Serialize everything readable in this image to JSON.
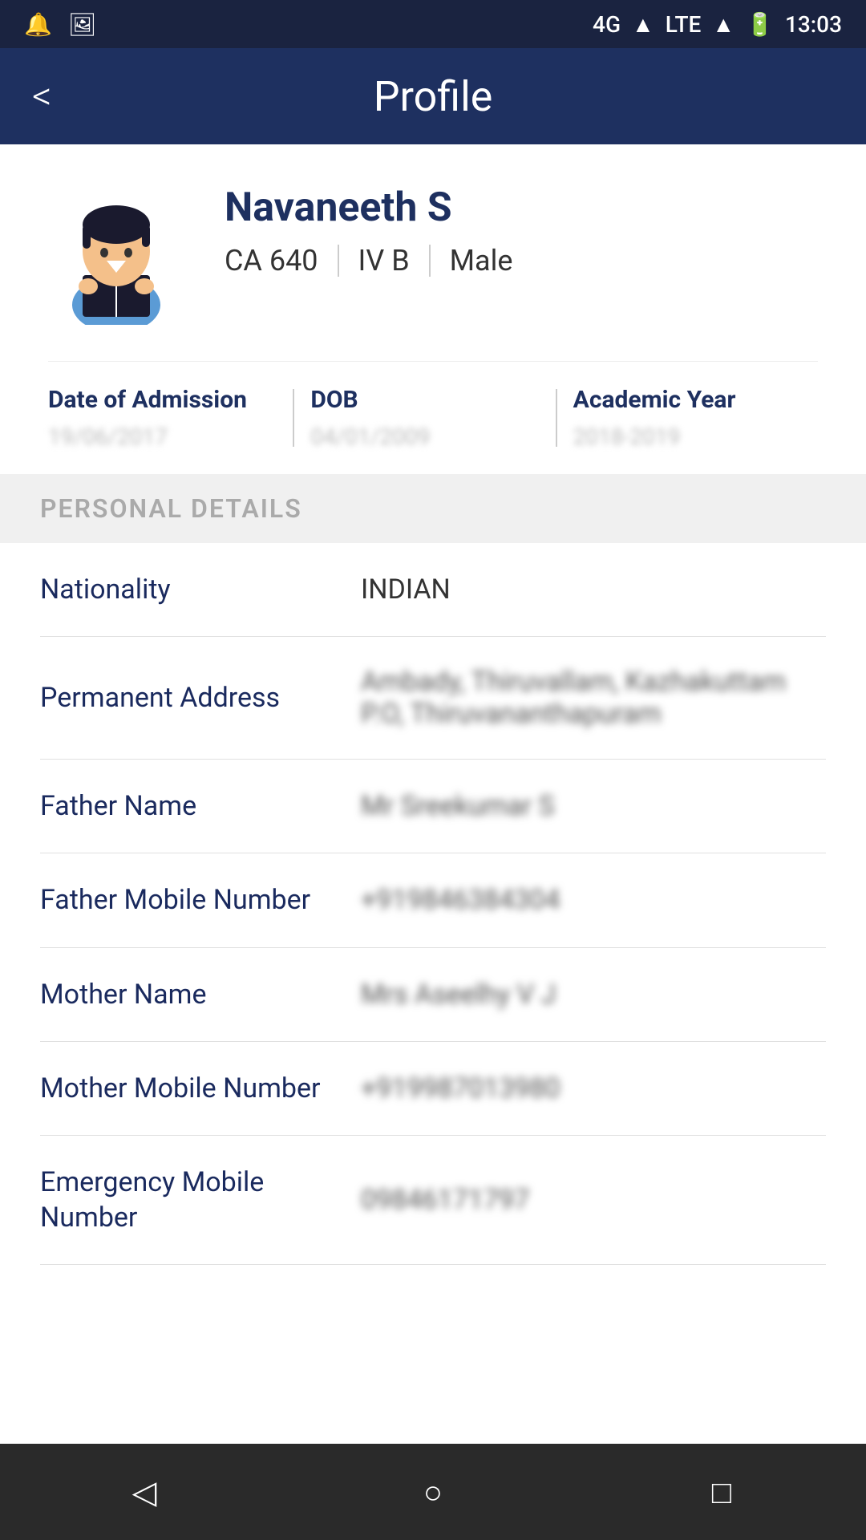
{
  "statusBar": {
    "time": "13:03",
    "network": "4G",
    "network2": "LTE"
  },
  "header": {
    "title": "Profile",
    "backLabel": "<"
  },
  "profile": {
    "name": "Navaneeth S",
    "rollNumber": "CA 640",
    "class": "IV B",
    "gender": "Male",
    "dateOfAdmission": {
      "label": "Date of Admission",
      "value": "19/06/2017"
    },
    "dob": {
      "label": "DOB",
      "value": "04/01/2009"
    },
    "academicYear": {
      "label": "Academic Year",
      "value": "2018-2019"
    }
  },
  "personalDetails": {
    "sectionTitle": "PERSONAL DETAILS",
    "rows": [
      {
        "label": "Nationality",
        "value": "INDIAN",
        "blurred": false
      },
      {
        "label": "Permanent Address",
        "value": "Ambady, Thiruvallam, Kazhakuttam P.O, Thiruvananthapuram",
        "blurred": true
      },
      {
        "label": "Father Name",
        "value": "Mr Sreekumar S",
        "blurred": true
      },
      {
        "label": "Father Mobile Number",
        "value": "+919846384304",
        "blurred": true
      },
      {
        "label": "Mother Name",
        "value": "Mrs Aseelhy V J",
        "blurred": true
      },
      {
        "label": "Mother Mobile Number",
        "value": "+919987013980",
        "blurred": true
      },
      {
        "label": "Emergency Mobile Number",
        "value": "09846171797",
        "blurred": true
      }
    ]
  },
  "bottomNav": {
    "backIcon": "◁",
    "homeIcon": "○",
    "recentIcon": "□"
  }
}
